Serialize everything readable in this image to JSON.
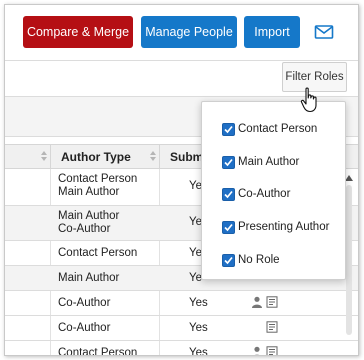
{
  "toolbar": {
    "compare_merge": "Compare & Merge",
    "manage_people": "Manage People",
    "import": "Import",
    "mail_icon": "envelope-icon"
  },
  "filter": {
    "label": "Filter Roles",
    "options": [
      {
        "label": "Contact Person",
        "checked": true
      },
      {
        "label": "Main Author",
        "checked": true
      },
      {
        "label": "Co-Author",
        "checked": true
      },
      {
        "label": "Presenting Author",
        "checked": true
      },
      {
        "label": "No Role",
        "checked": true
      }
    ]
  },
  "table": {
    "columns": [
      "Author Type",
      "Subm"
    ],
    "rows": [
      {
        "type_line1": "Contact Person",
        "type_line2": "Main Author",
        "submitted": "Ye",
        "icons": []
      },
      {
        "type_line1": "Main Author",
        "type_line2": "Co-Author",
        "submitted": "Ye",
        "icons": []
      },
      {
        "type_line1": "Contact Person",
        "type_line2": "",
        "submitted": "Ye",
        "icons": []
      },
      {
        "type_line1": "Main Author",
        "type_line2": "",
        "submitted": "Ye",
        "icons": []
      },
      {
        "type_line1": "Co-Author",
        "type_line2": "",
        "submitted": "Yes",
        "icons": [
          "person-icon",
          "form-icon"
        ]
      },
      {
        "type_line1": "Co-Author",
        "type_line2": "",
        "submitted": "Yes",
        "icons": [
          "form-icon"
        ]
      },
      {
        "type_line1": "Contact Person",
        "type_line2": "",
        "submitted": "Yes",
        "icons": [
          "person-icon",
          "form-icon"
        ]
      }
    ]
  },
  "colors": {
    "accent_red": "#b50f14",
    "accent_blue": "#1578c9",
    "checkbox_blue": "#1f6fc5"
  }
}
